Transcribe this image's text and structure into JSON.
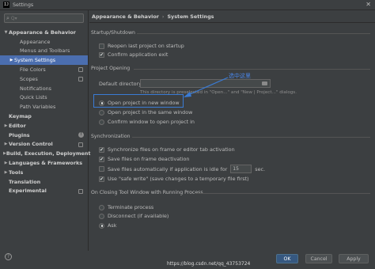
{
  "window": {
    "title": "Settings",
    "app_icon": "IJ",
    "close_glyph": "✕"
  },
  "search": {
    "placeholder": "Q▾",
    "value": ""
  },
  "tree": [
    {
      "label": "Appearance & Behavior",
      "arrow": "▼",
      "indent": 0,
      "bold": true
    },
    {
      "label": "Appearance",
      "indent": 2
    },
    {
      "label": "Menus and Toolbars",
      "indent": 2
    },
    {
      "label": "System Settings",
      "arrow": "▶",
      "indent": 1,
      "selected": true
    },
    {
      "label": "File Colors",
      "indent": 2,
      "icon": "copy-icon"
    },
    {
      "label": "Scopes",
      "indent": 2,
      "icon": "copy-icon"
    },
    {
      "label": "Notifications",
      "indent": 2
    },
    {
      "label": "Quick Lists",
      "indent": 2
    },
    {
      "label": "Path Variables",
      "indent": 2
    },
    {
      "label": "Keymap",
      "indent": 0,
      "bold": true
    },
    {
      "label": "Editor",
      "arrow": "▶",
      "indent": 0,
      "bold": true
    },
    {
      "label": "Plugins",
      "indent": 0,
      "bold": true,
      "icon": "info-icon"
    },
    {
      "label": "Version Control",
      "arrow": "▶",
      "indent": 0,
      "bold": true,
      "icon": "copy-icon"
    },
    {
      "label": "Build, Execution, Deployment",
      "arrow": "▶",
      "indent": 0,
      "bold": true
    },
    {
      "label": "Languages & Frameworks",
      "arrow": "▶",
      "indent": 0,
      "bold": true
    },
    {
      "label": "Tools",
      "arrow": "▶",
      "indent": 0,
      "bold": true
    },
    {
      "label": "Translation",
      "indent": 0,
      "bold": true
    },
    {
      "label": "Experimental",
      "indent": 0,
      "bold": true,
      "icon": "copy-icon"
    }
  ],
  "breadcrumb": {
    "parent": "Appearance & Behavior",
    "separator": "›",
    "current": "System Settings"
  },
  "startup": {
    "title": "Startup/Shutdown",
    "reopen": {
      "label": "Reopen last project on startup",
      "checked": false
    },
    "confirm_exit": {
      "label": "Confirm application exit",
      "checked": true
    }
  },
  "project_opening": {
    "title": "Project Opening",
    "default_dir_label": "Default directory:",
    "default_dir_value": "",
    "hint": "This directory is preselected in \"Open...\" and \"New | Project...\" dialogs.",
    "options": [
      {
        "label": "Open project in new window",
        "selected": true
      },
      {
        "label": "Open project in the same window",
        "selected": false
      },
      {
        "label": "Confirm window to open project in",
        "selected": false
      }
    ]
  },
  "synchronization": {
    "title": "Synchronization",
    "sync_on_activation": {
      "label": "Synchronize files on frame or editor tab activation",
      "checked": true
    },
    "save_on_deactivation": {
      "label": "Save files on frame deactivation",
      "checked": true
    },
    "autosave": {
      "label": "Save files automatically if application is idle for",
      "checked": false,
      "value": "15",
      "unit": "sec."
    },
    "safe_write": {
      "label": "Use \"safe write\" (save changes to a temporary file first)",
      "checked": true
    }
  },
  "closing": {
    "title": "On Closing Tool Window with Running Process",
    "options": [
      {
        "label": "Terminate process",
        "selected": false
      },
      {
        "label": "Disconnect (if available)",
        "selected": false
      },
      {
        "label": "Ask",
        "selected": true
      }
    ]
  },
  "annotation": {
    "text": "选中这里",
    "color": "#4a86e8"
  },
  "buttons": {
    "ok": "OK",
    "cancel": "Cancel",
    "apply": "Apply"
  },
  "watermark": "https://blog.csdn.net/qq_43753724",
  "help_glyph": "?",
  "check_glyph": "✔",
  "colors": {
    "selection": "#4b6eaf",
    "ok_button": "#365880",
    "highlight_border": "#3a7bd5"
  }
}
